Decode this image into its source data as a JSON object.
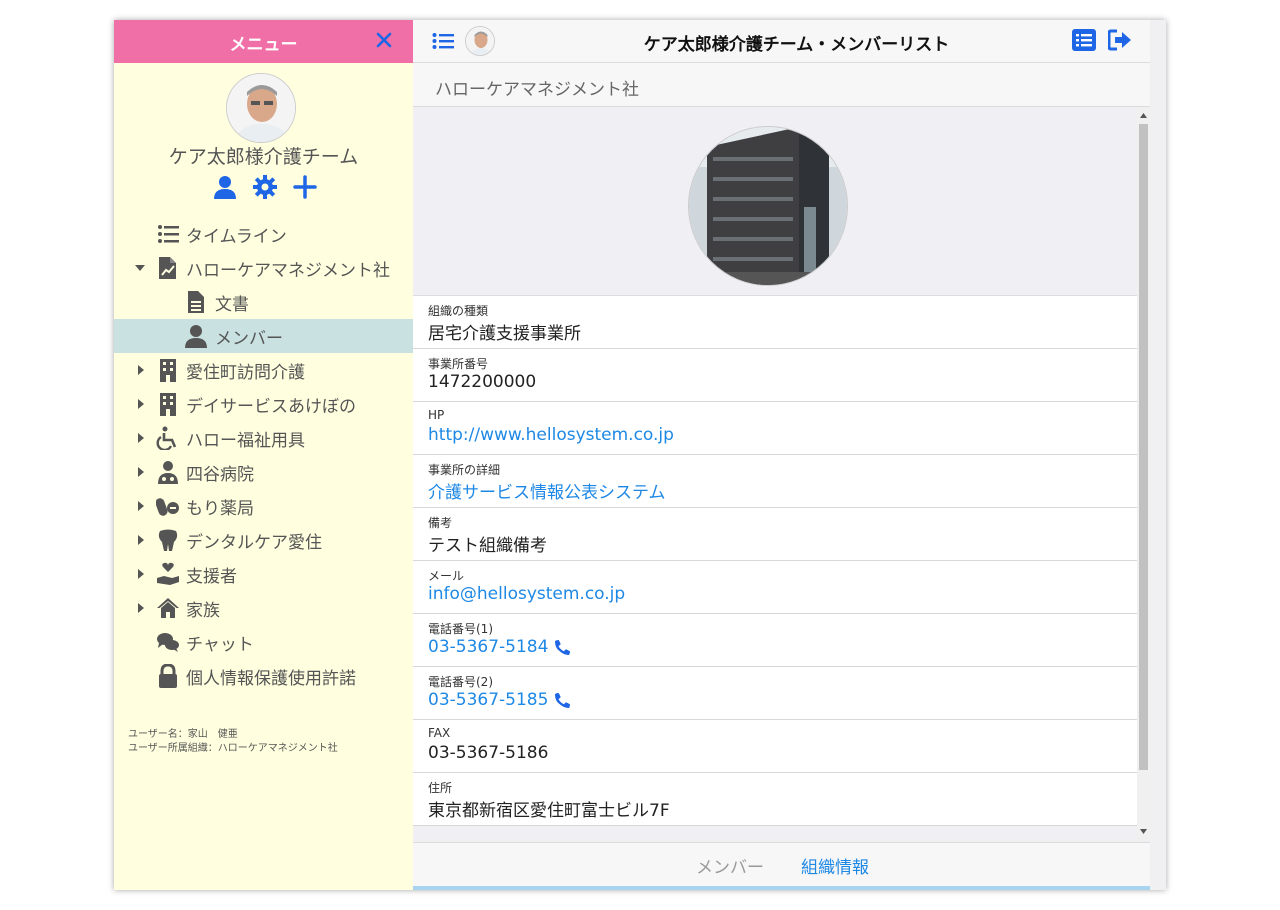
{
  "sidebar": {
    "title": "メニュー",
    "team_name": "ケア太郎様介護チーム",
    "items": [
      {
        "label": "タイムライン"
      },
      {
        "label": "ハローケアマネジメント社"
      },
      {
        "label": "文書"
      },
      {
        "label": "メンバー"
      },
      {
        "label": "愛住町訪問介護"
      },
      {
        "label": "デイサービスあけぼの"
      },
      {
        "label": "ハロー福祉用具"
      },
      {
        "label": "四谷病院"
      },
      {
        "label": "もり薬局"
      },
      {
        "label": "デンタルケア愛住"
      },
      {
        "label": "支援者"
      },
      {
        "label": "家族"
      },
      {
        "label": "チャット"
      },
      {
        "label": "個人情報保護使用許諾"
      }
    ],
    "user_name": "ユーザー名：家山　健亜",
    "user_org": "ユーザー所属組織：ハローケアマネジメント社"
  },
  "header": {
    "title": "ケア太郎様介護チーム・メンバーリスト"
  },
  "org_name": "ハローケアマネジメント社",
  "fields": [
    {
      "label": "組織の種類",
      "value": "居宅介護支援事業所"
    },
    {
      "label": "事業所番号",
      "value": "1472200000"
    },
    {
      "label": "HP",
      "value": "http://www.hellosystem.co.jp"
    },
    {
      "label": "事業所の詳細",
      "value": "介護サービス情報公表システム"
    },
    {
      "label": "備考",
      "value": "テスト組織備考"
    },
    {
      "label": "メール",
      "value": "info@hellosystem.co.jp"
    },
    {
      "label": "電話番号(1)",
      "value": "03-5367-5184"
    },
    {
      "label": "電話番号(2)",
      "value": "03-5367-5185"
    },
    {
      "label": "FAX",
      "value": "03-5367-5186"
    },
    {
      "label": "住所",
      "value": "東京都新宿区愛住町富士ビル7F"
    }
  ],
  "tabs": {
    "members": "メンバー",
    "org_info": "組織情報"
  },
  "colors": {
    "header_pink": "#ef6fa6",
    "sidebar_bg": "#ffffe0",
    "active_row": "#c9e1e0",
    "accent_blue": "#1e88e5"
  }
}
